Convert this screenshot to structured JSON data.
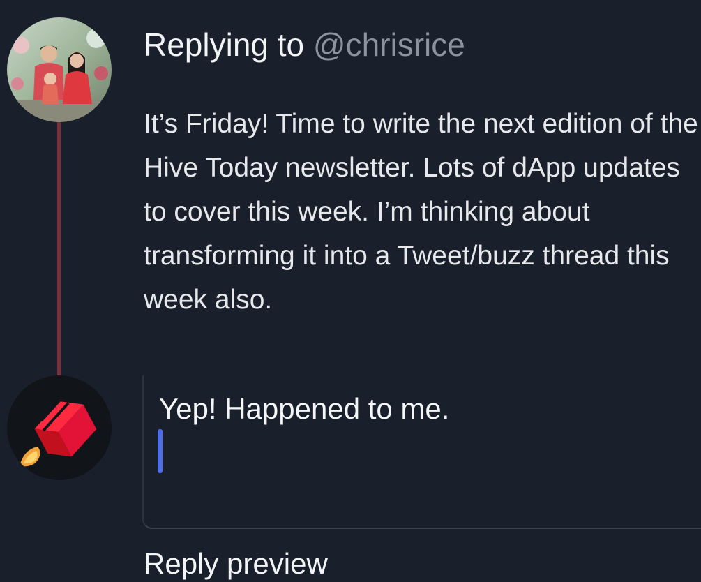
{
  "thread": {
    "parent": {
      "reply_prefix": "Replying to",
      "reply_handle": "@chrisrice",
      "body": "It’s Friday! Time to write the next edition of the Hive Today newsletter. Lots of dApp updates to cover this week. I’m thinking about transforming it into a Tweet/buzz thread this week also."
    },
    "compose": {
      "value": "Yep! Happened to me."
    },
    "preview_heading": "Reply preview"
  },
  "colors": {
    "background": "#1a202b",
    "thread_line": "#7a3038",
    "handle": "#8b939e",
    "caret": "#4d6ee8",
    "hive_logo": "#e31337"
  },
  "icons": {
    "top_avatar": "user-photo-avatar",
    "bottom_avatar": "hive-rocket-logo-icon"
  }
}
